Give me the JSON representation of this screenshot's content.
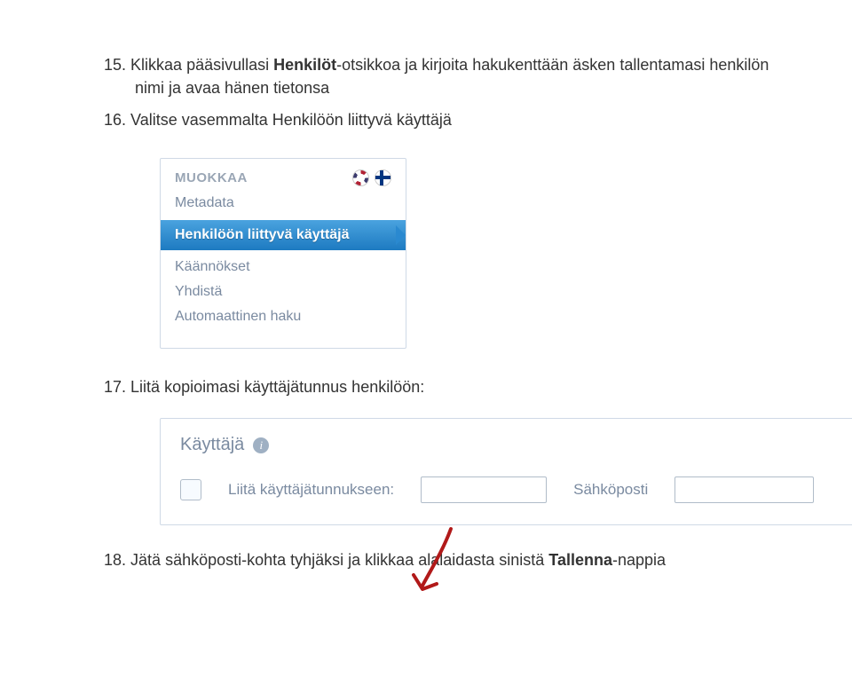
{
  "step15": {
    "num": "15.",
    "prefix": "Klikkaa pääsivullasi ",
    "bold": "Henkilöt",
    "rest": "-otsikkoa ja kirjoita hakukenttään äsken tallentamasi henkilön nimi ja avaa hänen tietonsa"
  },
  "step16": {
    "num": "16.",
    "text": "Valitse vasemmalta Henkilöön liittyvä käyttäjä"
  },
  "editPanel": {
    "title": "MUOKKAA",
    "items": {
      "metadata": "Metadata",
      "linked_user": "Henkilöön liittyvä käyttäjä",
      "translations": "Käännökset",
      "merge": "Yhdistä",
      "autosearch": "Automaattinen haku"
    }
  },
  "step17": {
    "num": "17.",
    "text": "Liitä kopioimasi käyttäjätunnus henkilöön:"
  },
  "userPanel": {
    "title": "Käyttäjä",
    "attach_label": "Liitä käyttäjätunnukseen:",
    "email_label": "Sähköposti"
  },
  "step18": {
    "num": "18.",
    "prefix": "Jätä sähköposti-kohta tyhjäksi ja klikkaa alalaidasta sinistä ",
    "bold": "Tallenna",
    "suffix": "-nappia"
  }
}
